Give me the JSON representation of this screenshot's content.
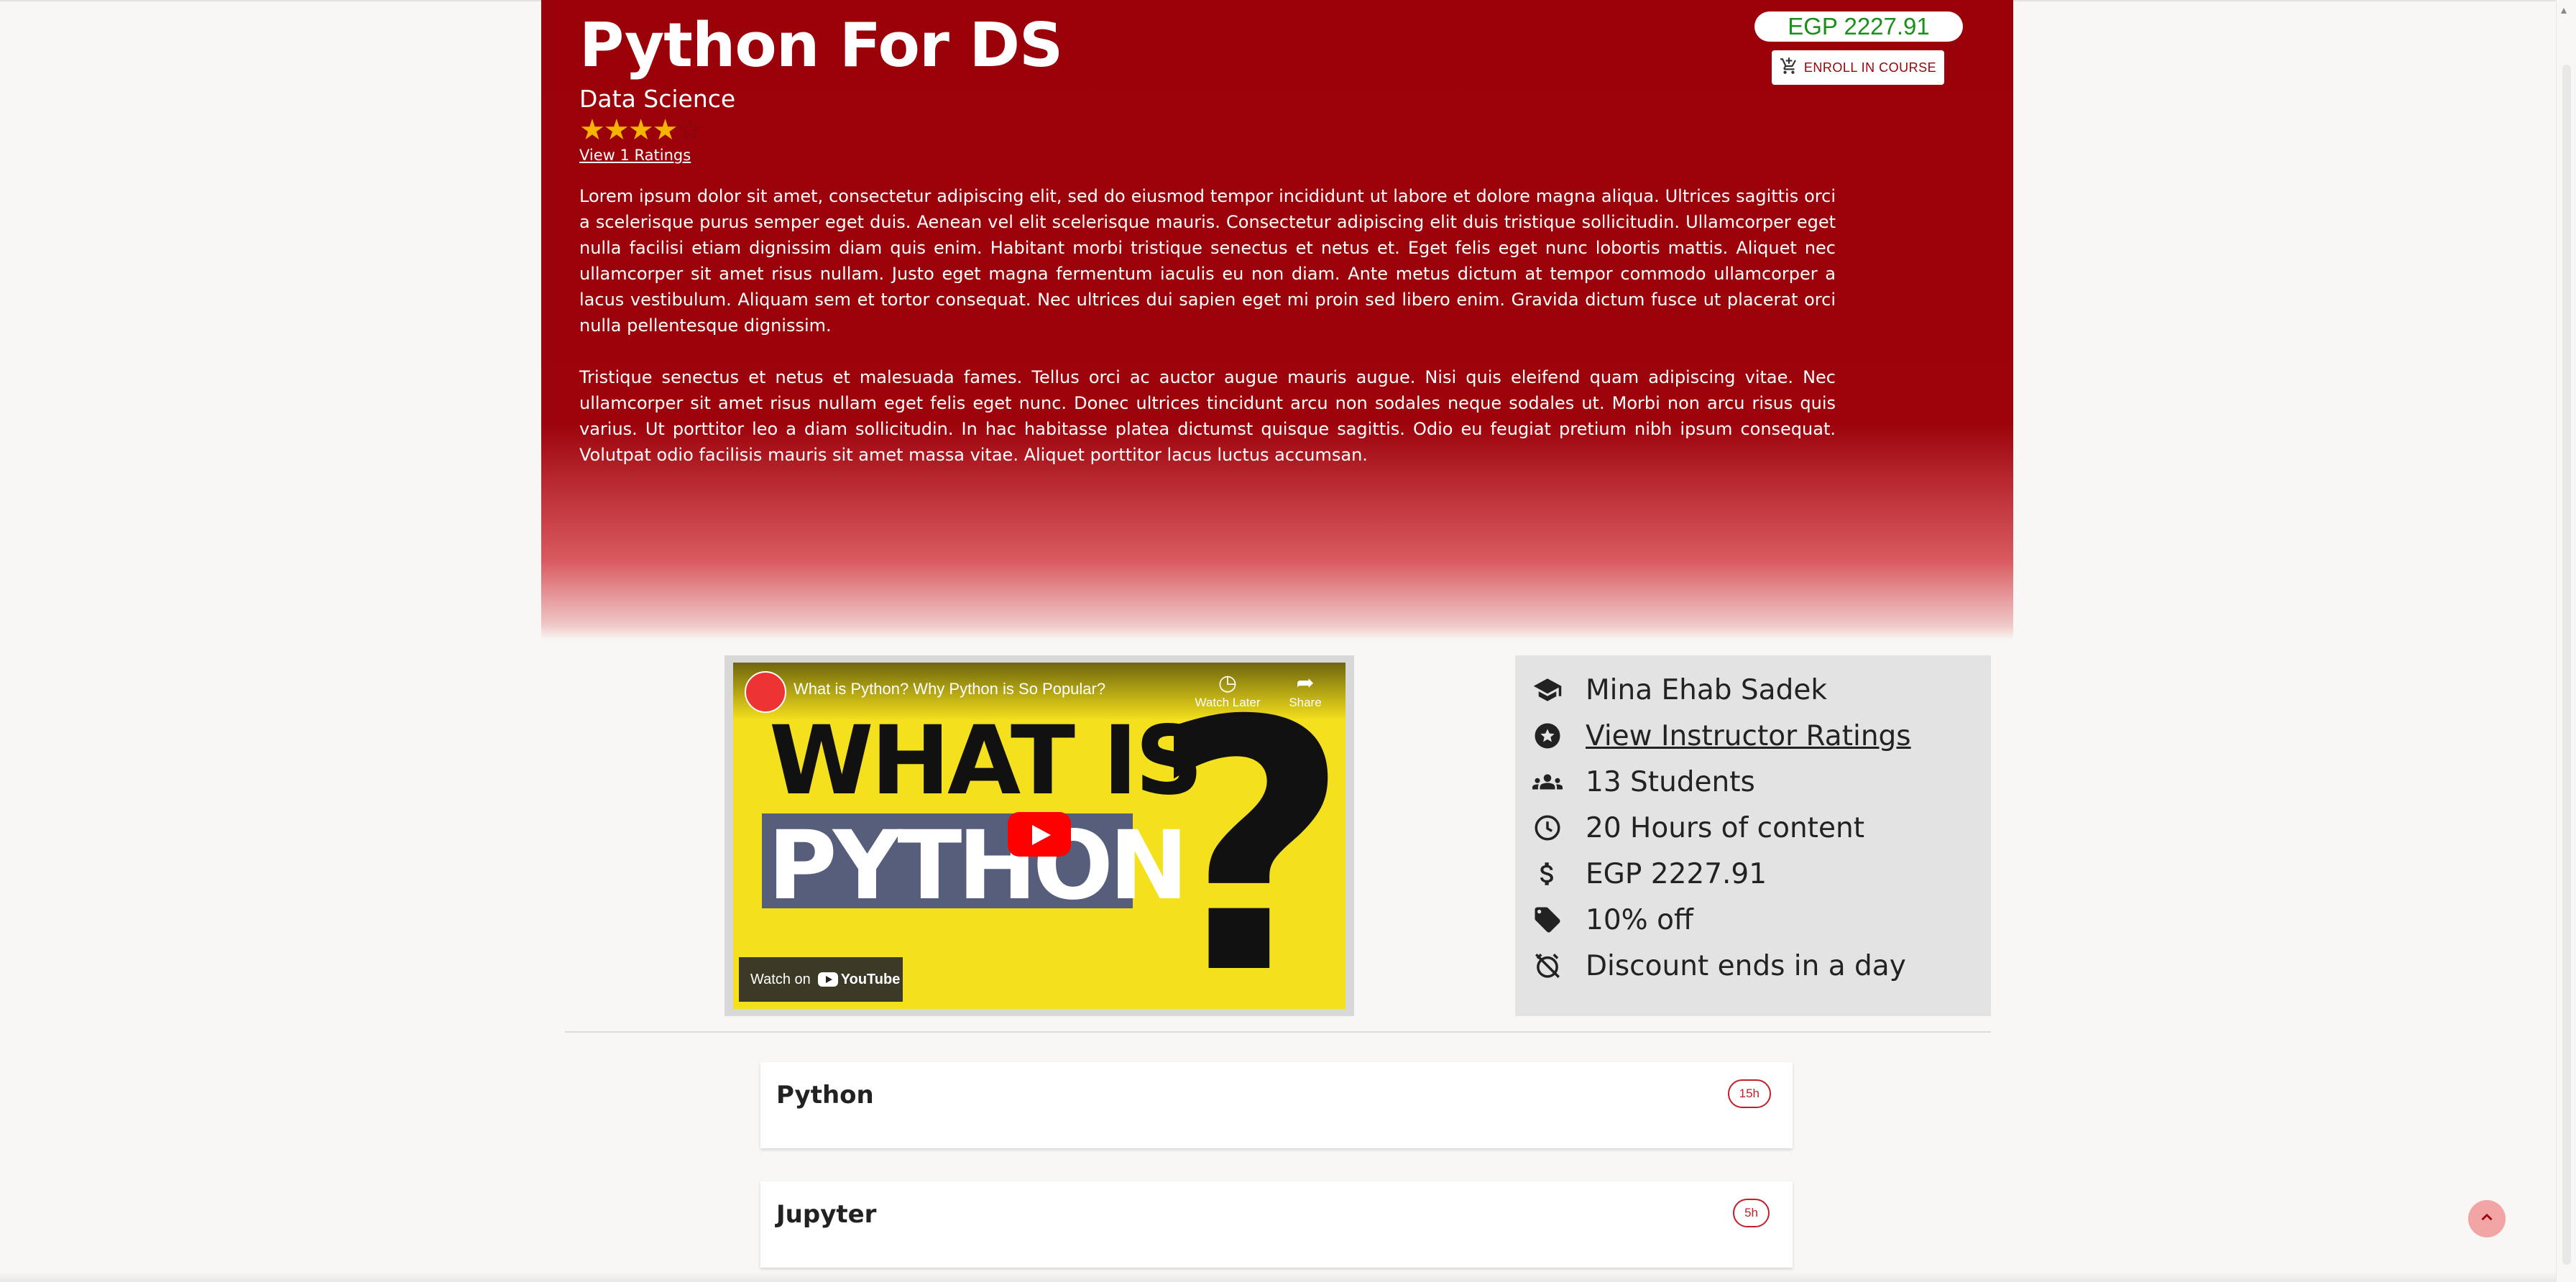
{
  "course": {
    "title": "Python For DS",
    "category": "Data Science",
    "rating_stars": 4,
    "rating_max": 5,
    "view_ratings_label": "View 1 Ratings",
    "description": [
      "Lorem ipsum dolor sit amet, consectetur adipiscing elit, sed do eiusmod tempor incididunt ut labore et dolore magna aliqua. Ultrices sagittis orci a scelerisque purus semper eget duis. Aenean vel elit scelerisque mauris. Consectetur adipiscing elit duis tristique sollicitudin. Ullamcorper eget nulla facilisi etiam dignissim diam quis enim. Habitant morbi tristique senectus et netus et. Eget felis eget nunc lobortis mattis. Aliquet nec ullamcorper sit amet risus nullam. Justo eget magna fermentum iaculis eu non diam. Ante metus dictum at tempor commodo ullamcorper a lacus vestibulum. Aliquam sem et tortor consequat. Nec ultrices dui sapien eget mi proin sed libero enim. Gravida dictum fusce ut placerat orci nulla pellentesque dignissim.",
      "Tristique senectus et netus et malesuada fames. Tellus orci ac auctor augue mauris augue. Nisi quis eleifend quam adipiscing vitae. Nec ullamcorper sit amet risus nullam eget felis eget nunc. Donec ultrices tincidunt arcu non sodales neque sodales ut. Morbi non arcu risus quis varius. Ut porttitor leo a diam sollicitudin. In hac habitasse platea dictumst quisque sagittis. Odio eu feugiat pretium nibh ipsum consequat. Volutpat odio facilisis mauris sit amet massa vitae. Aliquet porttitor lacus luctus accumsan."
    ],
    "price": "EGP 2227.91",
    "enroll_label": "ENROLL IN COURSE"
  },
  "video": {
    "title": "What is Python? Why Python is So Popular?",
    "watch_later_label": "Watch Later",
    "share_label": "Share",
    "thumb_line1": "WHAT IS",
    "thumb_line2": "PYTHON",
    "thumb_mark": "?",
    "watch_on_label": "Watch on",
    "youtube_label": "YouTube"
  },
  "info": {
    "instructor": "Mina Ehab Sadek",
    "instructor_ratings_link": "View Instructor Ratings",
    "students": "13 Students",
    "hours": "20 Hours of content",
    "price": "EGP 2227.91",
    "discount": "10% off",
    "discount_ends": "Discount ends in a day"
  },
  "sections": [
    {
      "name": "Python",
      "duration": "15h"
    },
    {
      "name": "Jupyter",
      "duration": "5h"
    }
  ],
  "colors": {
    "brand_red": "#9b0109",
    "price_green": "#1a8f1a",
    "star": "#f5b400"
  }
}
